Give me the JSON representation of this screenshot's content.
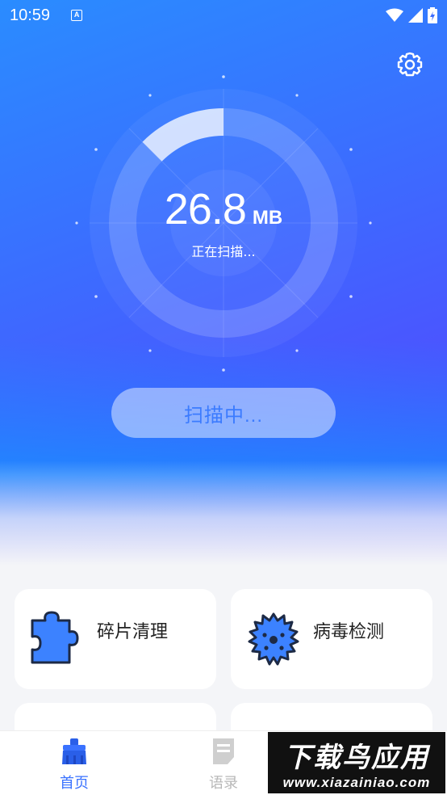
{
  "status_bar": {
    "time": "10:59",
    "notification_icon": "a-badge-icon",
    "indicators": [
      "wifi-icon",
      "signal-icon",
      "battery-charging-icon"
    ]
  },
  "header": {
    "settings_icon": "gear-icon"
  },
  "scan": {
    "size_value": "26.8",
    "size_unit": "MB",
    "status_text": "正在扫描...",
    "progress": 0.125,
    "button_label": "扫描中..."
  },
  "features": [
    {
      "label": "碎片清理",
      "icon": "puzzle-icon",
      "color": "#3c82ff"
    },
    {
      "label": "病毒检测",
      "icon": "virus-icon",
      "color": "#3c82ff"
    }
  ],
  "tabs": [
    {
      "label": "首页",
      "icon": "broom-icon",
      "active": true
    },
    {
      "label": "语录",
      "icon": "document-icon",
      "active": false
    }
  ],
  "watermark": {
    "title": "下载鸟应用",
    "url": "www.xiazainiao.com"
  },
  "colors": {
    "accent": "#3a72ff",
    "hero_start": "#2a8cff",
    "hero_end": "#5a3dff"
  }
}
